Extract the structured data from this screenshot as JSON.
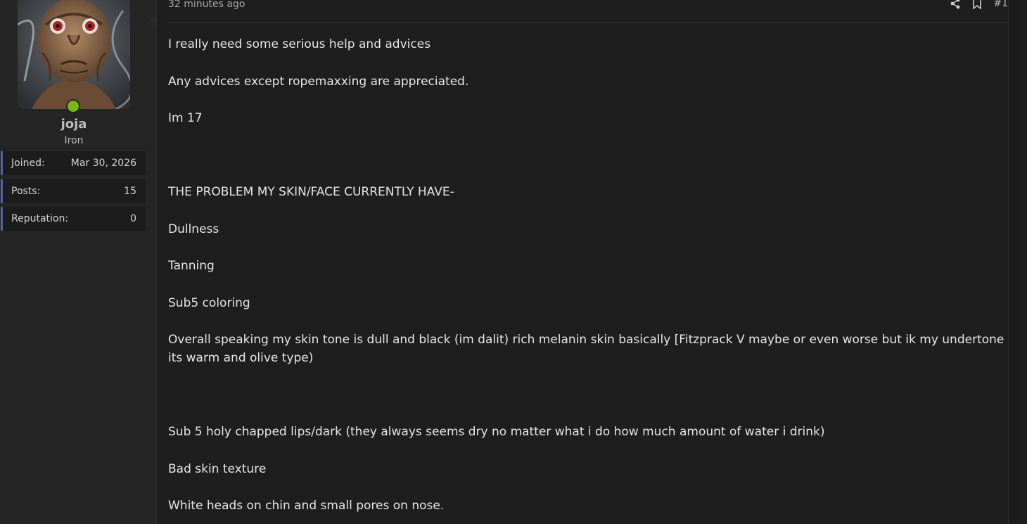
{
  "user": {
    "username": "joja",
    "title": "Iron",
    "stats": [
      {
        "label": "Joined:",
        "value": "Mar 30, 2026"
      },
      {
        "label": "Posts:",
        "value": "15"
      },
      {
        "label": "Reputation:",
        "value": "0"
      }
    ],
    "online": true
  },
  "post": {
    "time": "32 minutes ago",
    "post_number": "#1",
    "share_icon": "share-icon",
    "bookmark_icon": "bookmark-icon",
    "paragraphs": [
      "I really need some serious help and advices",
      "Any advices except ropemaxxing are appreciated.",
      "Im 17",
      "",
      "THE PROBLEM MY SKIN/FACE CURRENTLY HAVE-",
      "Dullness",
      "Tanning",
      "Sub5 coloring",
      "Overall speaking my skin tone is dull and black (im dalit) rich melanin skin basically [Fitzprack V maybe or even worse but ik my undertone its warm and olive type)",
      "",
      "Sub 5 holy chapped lips/dark (they always seems dry no matter what i do how much amount of water i drink)",
      "Bad skin texture",
      "White heads on chin and small pores on nose."
    ]
  },
  "colors": {
    "background": "#1e1e1e",
    "sidebar": "#252526",
    "stat_accent": "#5561a6",
    "online": "#7cb518"
  }
}
